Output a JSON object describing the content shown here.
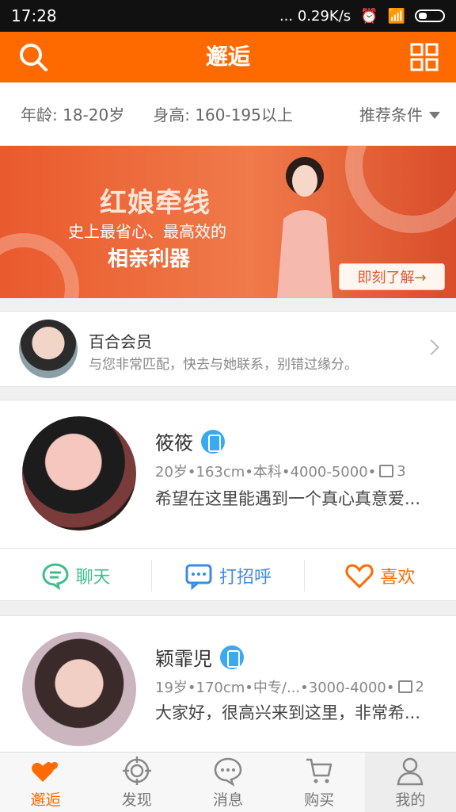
{
  "status_bar": {
    "time": "17:28",
    "net_speed": "... 0.29K/s"
  },
  "header": {
    "title": "邂逅"
  },
  "filters": {
    "age": "年龄: 18-20岁",
    "height": "身高: 160-195以上",
    "recommend": "推荐条件"
  },
  "banner": {
    "title": "红娘牵线",
    "line1": "史上最省心、最高效的",
    "line2": "相亲利器",
    "cta": "即刻了解→"
  },
  "member_card": {
    "title": "百合会员",
    "desc": "与您非常匹配，快去与她联系，别错过缘分。"
  },
  "profiles": [
    {
      "name": "筱筱",
      "info": "20岁•163cm•本科•4000-5000•",
      "photos": "3",
      "bio": "希望在这里能遇到一个真心真意爱..."
    },
    {
      "name": "颖霏児",
      "info": "19岁•170cm•中专/...•3000-4000•",
      "photos": "2",
      "bio": "大家好，很高兴来到这里，非常希..."
    }
  ],
  "actions": {
    "chat": "聊天",
    "greet": "打招呼",
    "like": "喜欢"
  },
  "tabs": [
    {
      "label": "邂逅",
      "icon": "hearts-icon"
    },
    {
      "label": "发现",
      "icon": "target-icon"
    },
    {
      "label": "消息",
      "icon": "message-icon"
    },
    {
      "label": "购买",
      "icon": "cart-icon"
    },
    {
      "label": "我的",
      "icon": "person-icon"
    }
  ],
  "colors": {
    "brand": "#ff6a00",
    "chat": "#3bbf8a",
    "greet": "#3c8be6",
    "verified": "#3aa9ee"
  }
}
